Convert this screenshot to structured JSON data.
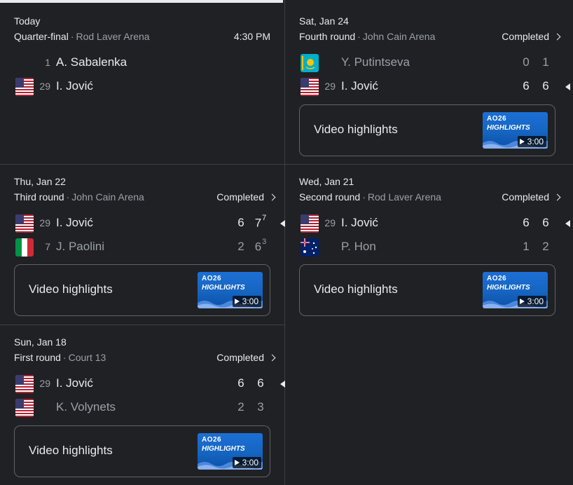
{
  "matches": [
    {
      "date": "Today",
      "round": "Quarter-final",
      "venue": "Rod Laver Arena",
      "time": "4:30 PM",
      "players": [
        {
          "seed": "1",
          "name": "A. Sabalenka",
          "flag": "none",
          "scores": []
        },
        {
          "seed": "29",
          "name": "I. Jović",
          "flag": "usa",
          "scores": []
        }
      ]
    },
    {
      "date": "Sat, Jan 24",
      "round": "Fourth round",
      "venue": "John Cain Arena",
      "status": "Completed",
      "players": [
        {
          "seed": "",
          "name": "Y. Putintseva",
          "flag": "kazakhstan",
          "scores": [
            "0",
            "1"
          ],
          "winner": false
        },
        {
          "seed": "29",
          "name": "I. Jović",
          "flag": "usa",
          "scores": [
            "6",
            "6"
          ],
          "winner": true
        }
      ],
      "video": {
        "label": "Video highlights",
        "duration": "3:00",
        "brand": "AO26",
        "title": "HIGHLIGHTS"
      }
    },
    {
      "date": "Thu, Jan 22",
      "round": "Third round",
      "venue": "John Cain Arena",
      "status": "Completed",
      "players": [
        {
          "seed": "29",
          "name": "I. Jović",
          "flag": "usa",
          "scores": [
            "6",
            "7"
          ],
          "tiebreaks": [
            "",
            "7"
          ],
          "winner": true
        },
        {
          "seed": "7",
          "name": "J. Paolini",
          "flag": "italy",
          "scores": [
            "2",
            "6"
          ],
          "tiebreaks": [
            "",
            "3"
          ],
          "winner": false
        }
      ],
      "video": {
        "label": "Video highlights",
        "duration": "3:00",
        "brand": "AO26",
        "title": "HIGHLIGHTS"
      }
    },
    {
      "date": "Wed, Jan 21",
      "round": "Second round",
      "venue": "Rod Laver Arena",
      "status": "Completed",
      "players": [
        {
          "seed": "29",
          "name": "I. Jović",
          "flag": "usa",
          "scores": [
            "6",
            "6"
          ],
          "winner": true
        },
        {
          "seed": "",
          "name": "P. Hon",
          "flag": "australia",
          "scores": [
            "1",
            "2"
          ],
          "winner": false
        }
      ],
      "video": {
        "label": "Video highlights",
        "duration": "3:00",
        "brand": "AO26",
        "title": "HIGHLIGHTS"
      }
    },
    {
      "date": "Sun, Jan 18",
      "round": "First round",
      "venue": "Court 13",
      "status": "Completed",
      "players": [
        {
          "seed": "29",
          "name": "I. Jović",
          "flag": "usa",
          "scores": [
            "6",
            "6"
          ],
          "winner": true
        },
        {
          "seed": "",
          "name": "K. Volynets",
          "flag": "usa",
          "scores": [
            "2",
            "3"
          ],
          "winner": false
        }
      ],
      "video": {
        "label": "Video highlights",
        "duration": "3:00",
        "brand": "AO26",
        "title": "HIGHLIGHTS"
      }
    }
  ],
  "colors": {
    "background": "#202124",
    "text": "#e8eaed",
    "muted": "#9aa0a6",
    "divider": "#3c4043",
    "thumbnail": "#1565c0"
  }
}
